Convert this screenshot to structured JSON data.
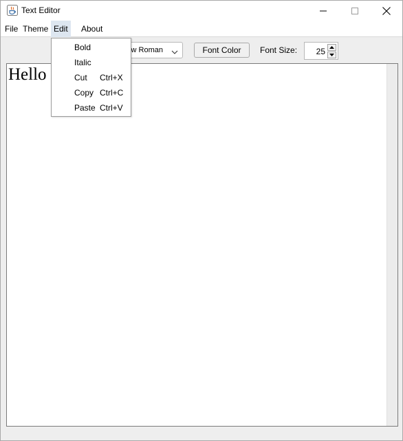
{
  "window": {
    "title": "Text Editor",
    "icon": "java-cup-icon"
  },
  "menubar": {
    "items": [
      {
        "label": "File"
      },
      {
        "label": "Theme"
      },
      {
        "label": "Edit"
      },
      {
        "label": "About"
      }
    ]
  },
  "toolbar": {
    "font_family_value": "ew Roman",
    "font_color_label": "Font Color",
    "font_size_label": "Font Size:",
    "font_size_value": "25"
  },
  "editor": {
    "text": "Hello"
  },
  "edit_menu": {
    "items": [
      {
        "label": "Bold",
        "accelerator": ""
      },
      {
        "label": "Italic",
        "accelerator": ""
      },
      {
        "label": "Cut",
        "accelerator": "Ctrl+X"
      },
      {
        "label": "Copy",
        "accelerator": "Ctrl+C"
      },
      {
        "label": "Paste",
        "accelerator": "Ctrl+V"
      }
    ]
  }
}
